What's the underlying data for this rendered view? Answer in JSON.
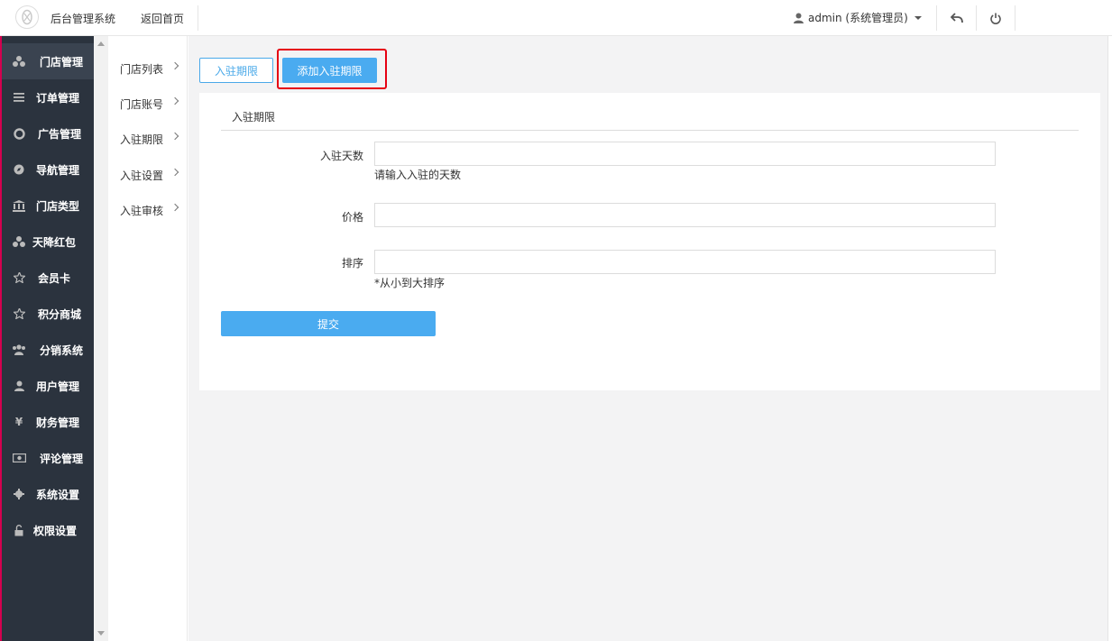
{
  "app": {
    "title": "后台管理系统",
    "back_home": "返回首页"
  },
  "user": {
    "label": "admin (系统管理员)"
  },
  "sidebar": {
    "items": [
      {
        "label": "门店管理",
        "icon": "cubes-icon",
        "active": true
      },
      {
        "label": "订单管理",
        "icon": "list-icon"
      },
      {
        "label": "广告管理",
        "icon": "lifebuoy-icon"
      },
      {
        "label": "导航管理",
        "icon": "compass-icon"
      },
      {
        "label": "门店类型",
        "icon": "bank-icon"
      },
      {
        "label": "天降红包",
        "icon": "cubes-icon"
      },
      {
        "label": "会员卡",
        "icon": "star-half-icon"
      },
      {
        "label": "积分商城",
        "icon": "star-half-icon"
      },
      {
        "label": "分销系统",
        "icon": "users-icon"
      },
      {
        "label": "用户管理",
        "icon": "user-icon"
      },
      {
        "label": "财务管理",
        "icon": "yen-icon"
      },
      {
        "label": "评论管理",
        "icon": "money-icon"
      },
      {
        "label": "系统设置",
        "icon": "gear-icon"
      },
      {
        "label": "权限设置",
        "icon": "unlock-icon"
      }
    ]
  },
  "subnav": {
    "items": [
      {
        "label": "门店列表"
      },
      {
        "label": "门店账号"
      },
      {
        "label": "入驻期限"
      },
      {
        "label": "入驻设置"
      },
      {
        "label": "入驻审核"
      }
    ]
  },
  "tabs": {
    "list": "入驻期限",
    "add": "添加入驻期限"
  },
  "panel": {
    "title": "入驻期限"
  },
  "form": {
    "days_label": "入驻天数",
    "days_value": "",
    "days_help": "请输入入驻的天数",
    "price_label": "价格",
    "price_value": "",
    "sort_label": "排序",
    "sort_value": "",
    "sort_help": "*从小到大排序",
    "submit": "提交"
  },
  "colors": {
    "accent": "#4aabf0",
    "sidebar_bg": "#2b333e",
    "highlight": "#e60012"
  }
}
